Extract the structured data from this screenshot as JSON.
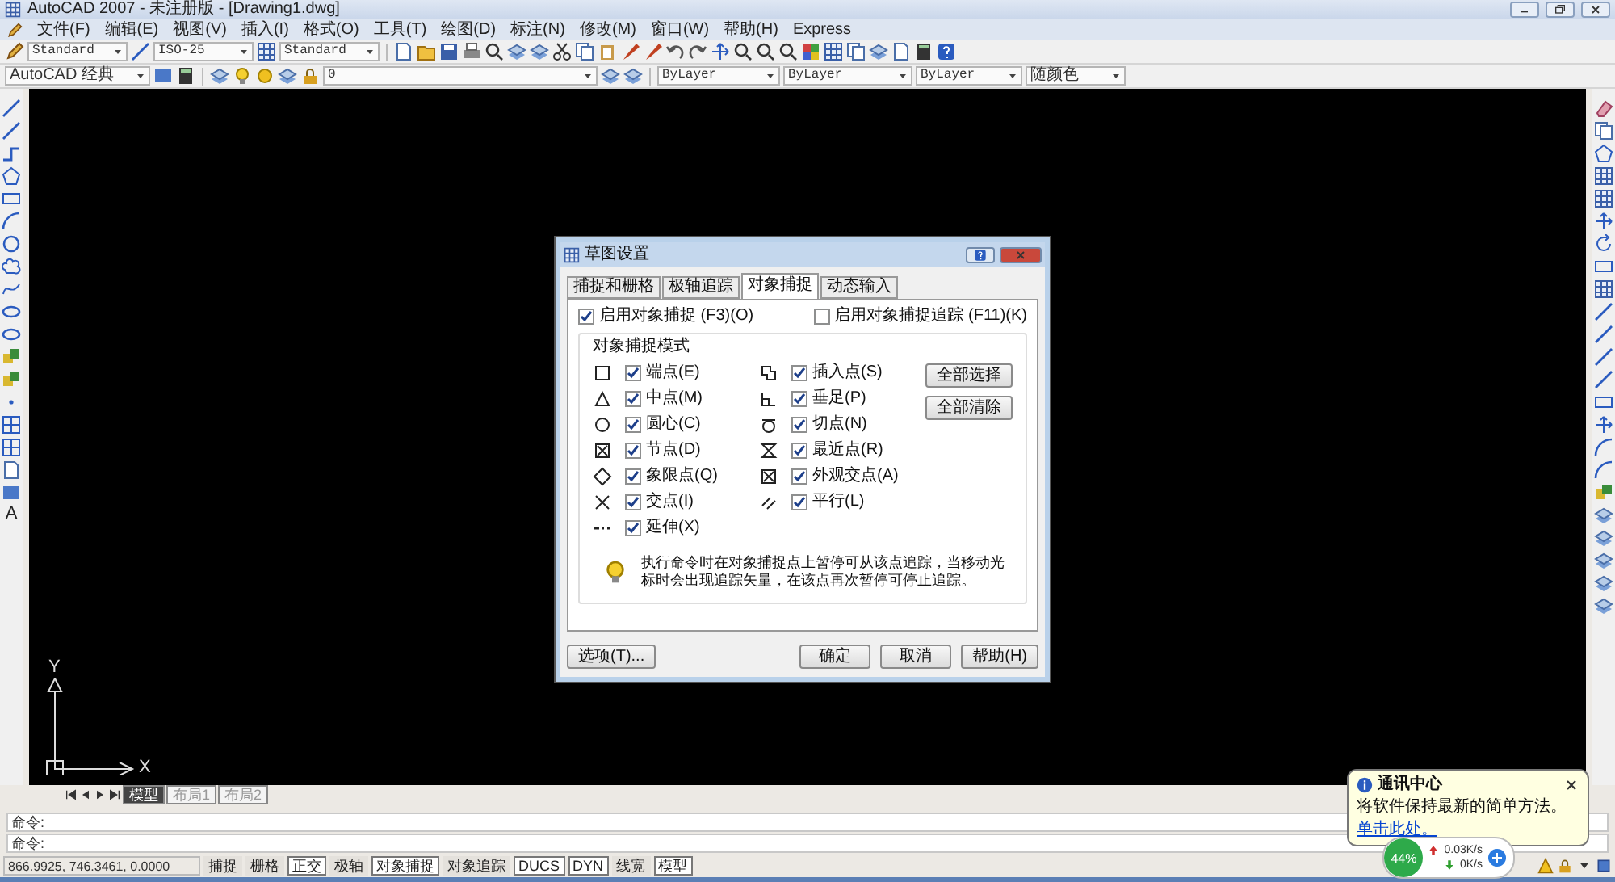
{
  "window": {
    "title": "AutoCAD 2007 - 未注册版 - [Drawing1.dwg]"
  },
  "menu": [
    "文件(F)",
    "编辑(E)",
    "视图(V)",
    "插入(I)",
    "格式(O)",
    "工具(T)",
    "绘图(D)",
    "标注(N)",
    "修改(M)",
    "窗口(W)",
    "帮助(H)",
    "Express"
  ],
  "styles_toolbar": {
    "text_style": "Standard",
    "dim_style": "ISO-25",
    "table_style": "Standard"
  },
  "layers_toolbar": {
    "workspace": "AutoCAD 经典",
    "layer": "0",
    "color_setting": "ByLayer",
    "linetype": "ByLayer",
    "lineweight": "ByLayer",
    "plot_style": "随颜色"
  },
  "left_toolbar": {
    "text_tool": "A"
  },
  "ucs": {
    "y": "Y",
    "x": "X"
  },
  "layout_tabs": [
    {
      "label": "模型",
      "selected": true
    },
    {
      "label": "布局1",
      "selected": false
    },
    {
      "label": "布局2",
      "selected": false
    }
  ],
  "command_lines": [
    "命令:",
    "命令:"
  ],
  "status_bar": {
    "coordinates": "866.9925, 746.3461, 0.0000",
    "toggles": [
      {
        "label": "捕捉",
        "on": false
      },
      {
        "label": "栅格",
        "on": false
      },
      {
        "label": "正交",
        "on": true
      },
      {
        "label": "极轴",
        "on": false
      },
      {
        "label": "对象捕捉",
        "on": true
      },
      {
        "label": "对象追踪",
        "on": false
      },
      {
        "label": "DUCS",
        "on": true
      },
      {
        "label": "DYN",
        "on": true
      },
      {
        "label": "线宽",
        "on": false
      },
      {
        "label": "模型",
        "on": true
      }
    ]
  },
  "dialog": {
    "title": "草图设置",
    "tabs": [
      {
        "label": "捕捉和栅格",
        "selected": false
      },
      {
        "label": "极轴追踪",
        "selected": false
      },
      {
        "label": "对象捕捉",
        "selected": true
      },
      {
        "label": "动态输入",
        "selected": false
      }
    ],
    "enable_snap": {
      "label": "启用对象捕捉 (F3)(O)",
      "checked": true
    },
    "enable_tracking": {
      "label": "启用对象捕捉追踪 (F11)(K)",
      "checked": false
    },
    "group_title": "对象捕捉模式",
    "modes_left": [
      {
        "kind": "square",
        "label": "端点(E)",
        "checked": true
      },
      {
        "kind": "triangle",
        "label": "中点(M)",
        "checked": true
      },
      {
        "kind": "circle",
        "label": "圆心(C)",
        "checked": true
      },
      {
        "kind": "node",
        "label": "节点(D)",
        "checked": true
      },
      {
        "kind": "diamond",
        "label": "象限点(Q)",
        "checked": true
      },
      {
        "kind": "cross",
        "label": "交点(I)",
        "checked": true
      },
      {
        "kind": "extension",
        "label": "延伸(X)",
        "checked": true
      }
    ],
    "modes_right": [
      {
        "kind": "insert",
        "label": "插入点(S)",
        "checked": true
      },
      {
        "kind": "perpendicular",
        "label": "垂足(P)",
        "checked": true
      },
      {
        "kind": "tangent",
        "label": "切点(N)",
        "checked": true
      },
      {
        "kind": "nearest",
        "label": "最近点(R)",
        "checked": true
      },
      {
        "kind": "apparent",
        "label": "外观交点(A)",
        "checked": true
      },
      {
        "kind": "parallel",
        "label": "平行(L)",
        "checked": true
      }
    ],
    "select_all": "全部选择",
    "clear_all": "全部清除",
    "hint": "执行命令时在对象捕捉点上暂停可从该点追踪，当移动光标时会出现追踪矢量，在该点再次暂停可停止追踪。",
    "options_button": "选项(T)...",
    "buttons": [
      "确定",
      "取消",
      "帮助(H)"
    ]
  },
  "notification": {
    "title": "通讯中心",
    "message": "将软件保持最新的简单方法。",
    "link": "单击此处。"
  },
  "network_widget": {
    "percent": "44%",
    "upload": "0.03K/s",
    "download": "0K/s"
  }
}
